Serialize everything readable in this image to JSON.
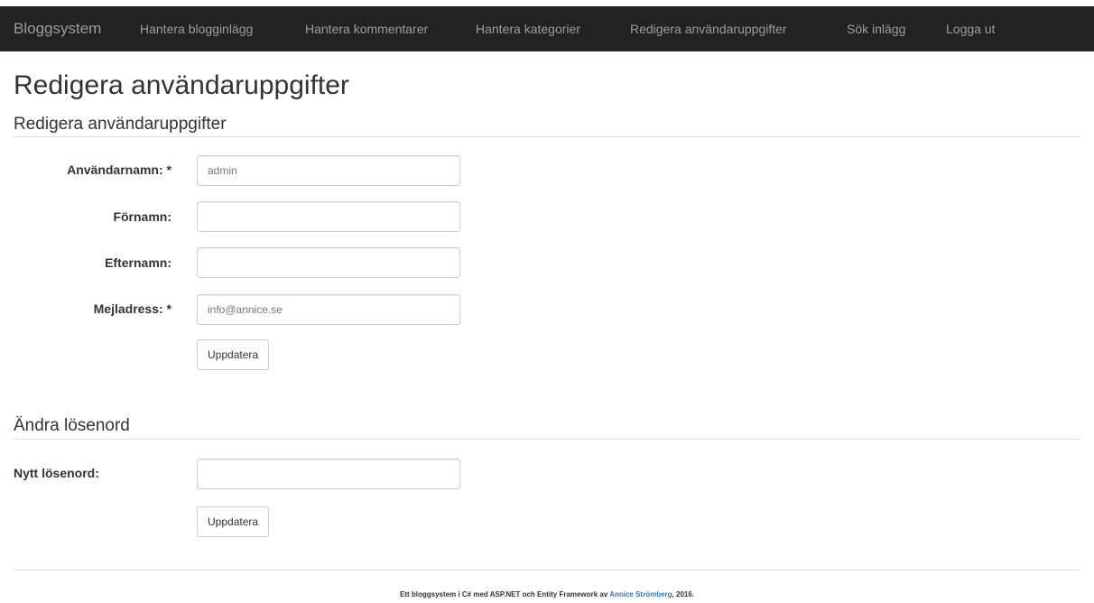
{
  "navbar": {
    "brand": "Bloggsystem",
    "items": [
      "Hantera blogginlägg",
      "Hantera kommentarer",
      "Hantera kategorier",
      "Redigera användaruppgifter",
      "Sök inlägg",
      "Logga ut"
    ]
  },
  "page_title": "Redigera användaruppgifter",
  "user_section": {
    "title": "Redigera användaruppgifter",
    "username": {
      "label": "Användarnamn: *",
      "value": "admin"
    },
    "firstname": {
      "label": "Förnamn:",
      "value": ""
    },
    "lastname": {
      "label": "Efternamn:",
      "value": ""
    },
    "email": {
      "label": "Mejladress: *",
      "value": "info@annice.se"
    },
    "submit_label": "Uppdatera"
  },
  "password_section": {
    "title": "Ändra lösenord",
    "new_password": {
      "label": "Nytt lösenord:",
      "value": ""
    },
    "submit_label": "Uppdatera"
  },
  "footer": {
    "text_before": "Ett bloggsystem i C# med ASP.NET och Entity Framework av ",
    "author_link": "Annice Strömberg",
    "text_after": ", 2016."
  }
}
